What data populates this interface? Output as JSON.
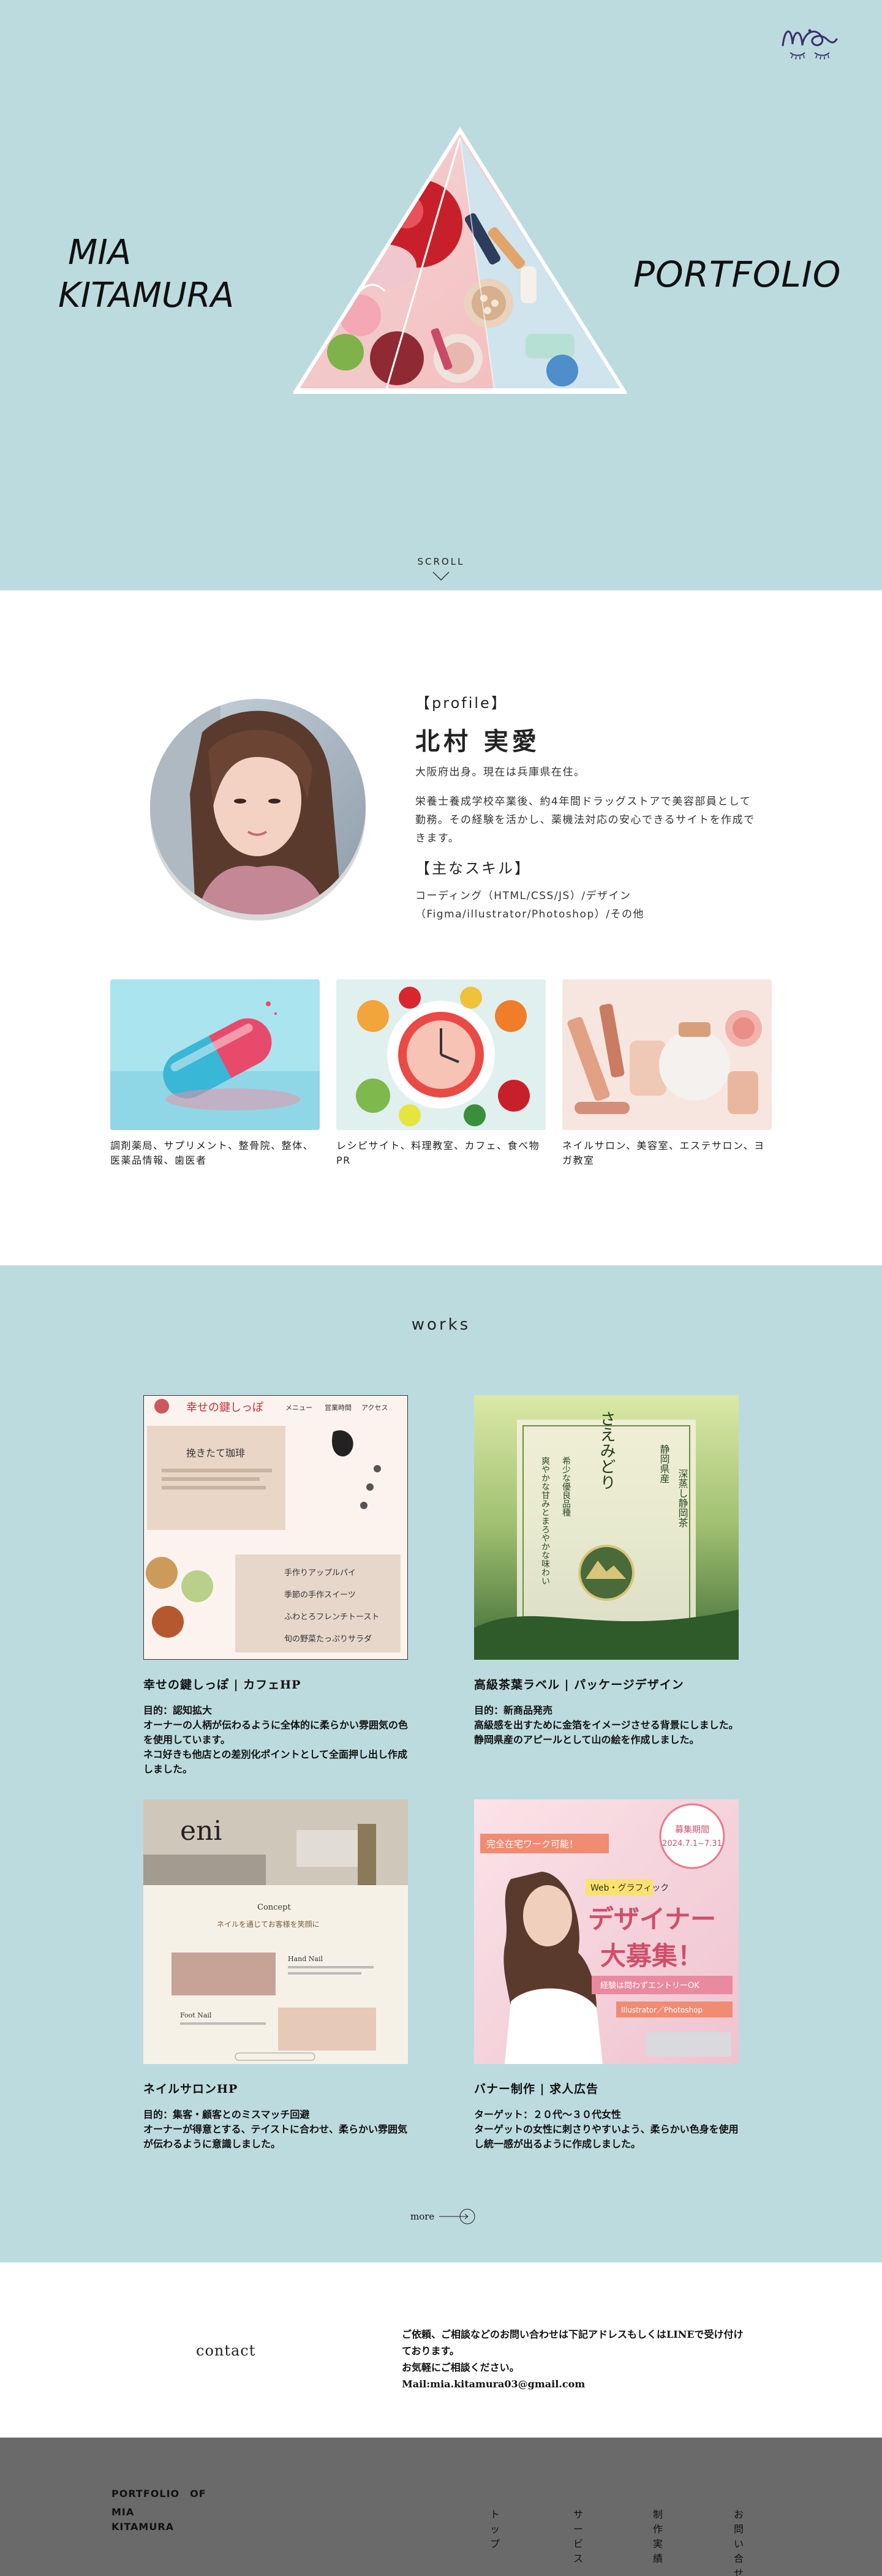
{
  "hero": {
    "name_line1": "MIA",
    "name_line2": "KITAMURA",
    "portfolio": "PORTFOLIO",
    "scroll": "SCROLL",
    "logo_text": "Mia",
    "background": "#bcdbdf"
  },
  "profile": {
    "heading": "【profile】",
    "name": "北村 実愛",
    "text1": "大阪府出身。現在は兵庫県在住。",
    "text2": "栄養士養成学校卒業後、約4年間ドラッグストアで美容部員として勤務。その経験を活かし、薬機法対応の安心できるサイトを作成できます。",
    "skills_heading": "【主なスキル】",
    "skills_text": "コーディング（HTML/CSS/JS）/デザイン（Figma/illustrator/Photoshop）/その他",
    "categories": [
      {
        "label": "調剤薬局、サプリメント、整骨院、整体、医薬品情報、歯医者"
      },
      {
        "label": "レシピサイト、料理教室、カフェ、食べ物PR"
      },
      {
        "label": "ネイルサロン、美容室、エステサロン、ヨガ教室"
      }
    ]
  },
  "works": {
    "title": "works",
    "items": [
      {
        "title": "幸せの鍵しっぽ | カフェHP",
        "desc": [
          "目的：認知拡大",
          "オーナーの人柄が伝わるように全体的に柔らかい雰囲気の色を使用しています。",
          "ネコ好きも他店との差別化ポイントとして全面押し出し作成しました。"
        ],
        "thumb": {
          "shop": "幸せの鍵しっぽ",
          "nav1": "メニュー",
          "nav2": "営業時間",
          "nav3": "アクセス",
          "coffee": "挽きたて珈琲",
          "menu1": "手作りアップルパイ",
          "menu2": "季節の手作スイーツ",
          "menu3": "ふわとろフレンチトースト",
          "menu4": "旬の野菜たっぷりサラダ"
        }
      },
      {
        "title": "高級茶葉ラベル | パッケージデザイン",
        "desc": [
          "目的：新商品発売",
          "高級感を出すために金箔をイメージさせる背景にしました。",
          "静岡県産のアピールとして山の絵を作成しました。"
        ],
        "thumb": {
          "name": "さえみどり",
          "left": "希少な優良品種",
          "left2": "爽やかな甘みとまろやかな味わい",
          "right": "静岡県産",
          "right2": "深蒸し静岡茶"
        }
      },
      {
        "title": "ネイルサロンHP",
        "desc": [
          "目的：集客・顧客とのミスマッチ回避",
          "オーナーが得意とする、テイストに合わせ、柔らかい雰囲気が伝わるように意識しました。"
        ],
        "thumb": {
          "logo": "eni",
          "concept": "Concept",
          "tagline": "ネイルを通じてお客様を笑顔に",
          "hand": "Hand Nail",
          "foot": "Foot Nail"
        }
      },
      {
        "title": "バナー制作 | 求人広告",
        "desc": [
          "ターゲット：２０代〜３０代女性",
          "ターゲットの女性に刺さりやすいよう、柔らかい色身を使用し統一感が出るように作成しました。"
        ],
        "thumb": {
          "badge1": "募集期間",
          "badge2": "2024.7.1~7.31",
          "tag": "完全在宅ワーク可能！",
          "field": "Web・グラフィック",
          "main1": "デザイナー",
          "main2": "大募集！",
          "note": "経験は問わずエントリーOK",
          "tools": "Illustrator／Photoshop"
        }
      }
    ],
    "more": "more"
  },
  "contact": {
    "title": "contact",
    "lines": [
      "ご依頼、ご相談などのお問い合わせは下記アドレスもしくはLINEで受け付けております。",
      "お気軽にご相談ください。",
      "Mail:mia.kitamura03@gmail.com"
    ]
  },
  "footer": {
    "brand1": "PORTFOLIO　OF",
    "brand2": "MIA",
    "brand3": "KITAMURA",
    "nav": [
      "トップ",
      "サービス",
      "制作実績",
      "お問い合せ"
    ]
  }
}
